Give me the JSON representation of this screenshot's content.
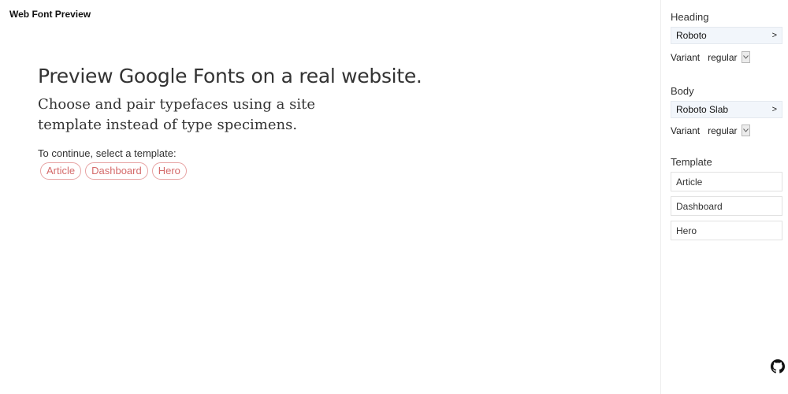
{
  "header": {
    "brand": "Web Font Preview"
  },
  "main": {
    "title": "Preview Google Fonts on a real website.",
    "subtitle": "Choose and pair typefaces using a site template instead of type specimens.",
    "prompt": "To continue, select a template:",
    "template_chips": [
      "Article",
      "Dashboard",
      "Hero"
    ]
  },
  "sidebar": {
    "heading": {
      "label": "Heading",
      "font": "Roboto",
      "arrow": ">",
      "variant_label": "Variant",
      "variant_value": "regular"
    },
    "body": {
      "label": "Body",
      "font": "Roboto Slab",
      "arrow": ">",
      "variant_label": "Variant",
      "variant_value": "regular"
    },
    "template": {
      "label": "Template",
      "items": [
        "Article",
        "Dashboard",
        "Hero"
      ]
    }
  },
  "icons": {
    "github": "github-icon"
  },
  "colors": {
    "chip_text": "#d46a6a",
    "chip_border": "#e7a3a3",
    "picker_bg": "#f2f6fb",
    "divider": "#ededed"
  }
}
